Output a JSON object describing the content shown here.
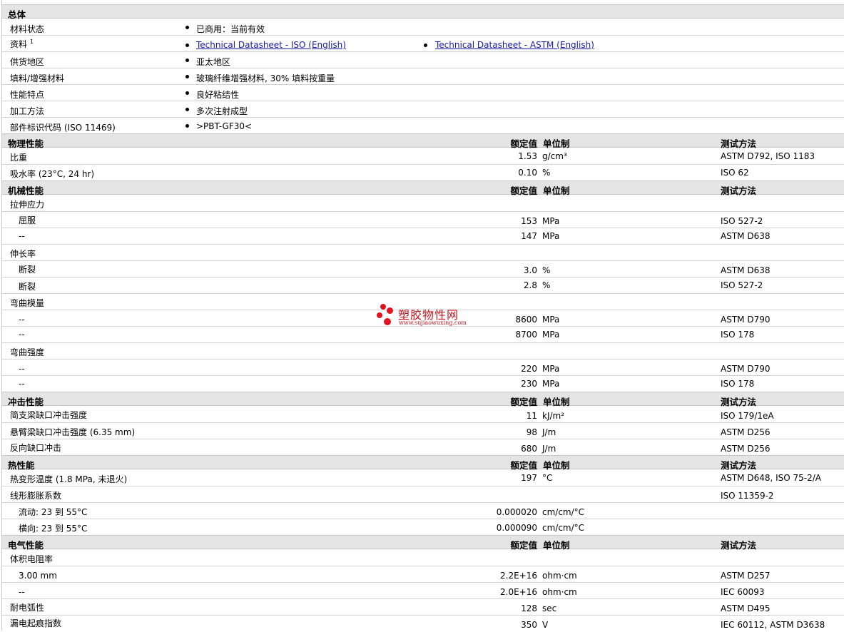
{
  "general": {
    "title": "总体",
    "material_status": {
      "label": "材料状态",
      "value": "已商用：当前有效"
    },
    "resources": {
      "label": "资料",
      "sup": "1",
      "links": [
        "Technical Datasheet - ISO (English)",
        "Technical Datasheet - ASTM (English)"
      ]
    },
    "supply_region": {
      "label": "供货地区",
      "value": "亚太地区"
    },
    "filler": {
      "label": "填料/增强材料",
      "value": "玻璃纤维增强材料, 30% 填料按重量"
    },
    "features": {
      "label": "性能特点",
      "value": "良好粘结性"
    },
    "processing": {
      "label": "加工方法",
      "value": "多次注射成型"
    },
    "part_marking": {
      "label": "部件标识代码",
      "label_note": "(ISO 11469)",
      "value": ">PBT-GF30<"
    }
  },
  "columns": {
    "nominal": "额定值",
    "unit": "单位制",
    "test": "测试方法"
  },
  "sections": {
    "physical": {
      "title": "物理性能",
      "rows": [
        {
          "label": "比重",
          "value": "1.53",
          "unit": "g/cm³",
          "test": "ASTM D792, ISO 1183"
        },
        {
          "label": "吸水率",
          "note": "(23°C, 24 hr)",
          "value": "0.10",
          "unit": "%",
          "test": "ISO 62"
        }
      ]
    },
    "mechanical": {
      "title": "机械性能",
      "tensile": {
        "label": "拉伸应力",
        "rows": [
          {
            "label": "屈服",
            "value": "153",
            "unit": "MPa",
            "test": "ISO 527-2"
          },
          {
            "label": "--",
            "value": "147",
            "unit": "MPa",
            "test": "ASTM D638"
          }
        ]
      },
      "elongation": {
        "label": "伸长率",
        "rows": [
          {
            "label": "断裂",
            "value": "3.0",
            "unit": "%",
            "test": "ASTM D638"
          },
          {
            "label": "断裂",
            "value": "2.8",
            "unit": "%",
            "test": "ISO 527-2"
          }
        ]
      },
      "flex_modulus": {
        "label": "弯曲模量",
        "rows": [
          {
            "label": "--",
            "value": "8600",
            "unit": "MPa",
            "test": "ASTM D790"
          },
          {
            "label": "--",
            "value": "8700",
            "unit": "MPa",
            "test": "ISO 178"
          }
        ]
      },
      "flex_strength": {
        "label": "弯曲强度",
        "rows": [
          {
            "label": "--",
            "value": "220",
            "unit": "MPa",
            "test": "ASTM D790"
          },
          {
            "label": "--",
            "value": "230",
            "unit": "MPa",
            "test": "ISO 178"
          }
        ]
      }
    },
    "impact": {
      "title": "冲击性能",
      "rows": [
        {
          "label": "简支梁缺口冲击强度",
          "value": "11",
          "unit": "kJ/m²",
          "test": "ISO 179/1eA"
        },
        {
          "label": "悬臂梁缺口冲击强度",
          "note": "(6.35 mm)",
          "value": "98",
          "unit": "J/m",
          "test": "ASTM D256"
        },
        {
          "label": "反向缺口冲击",
          "value": "680",
          "unit": "J/m",
          "test": "ASTM D256"
        }
      ]
    },
    "thermal": {
      "title": "热性能",
      "hdt": {
        "label": "热变形温度",
        "note": "(1.8 MPa, 未退火)",
        "value": "197",
        "unit": "°C",
        "test": "ASTM D648, ISO 75-2/A"
      },
      "clte": {
        "label": "线形膨胀系数",
        "test": "ISO 11359-2",
        "rows": [
          {
            "label": "流动: 23 到  55°C",
            "value": "0.000020",
            "unit": "cm/cm/°C"
          },
          {
            "label": "横向: 23 到  55°C",
            "value": "0.000090",
            "unit": "cm/cm/°C"
          }
        ]
      }
    },
    "electrical": {
      "title": "电气性能",
      "volume_resistivity": {
        "label": "体积电阻率",
        "rows": [
          {
            "label": "3.00 mm",
            "value": "2.2E+16",
            "unit": "ohm·cm",
            "test": "ASTM D257"
          },
          {
            "label": "--",
            "value": "2.0E+16",
            "unit": "ohm·cm",
            "test": "IEC 60093"
          }
        ]
      },
      "arc_resistance": {
        "label": "耐电弧性",
        "value": "128",
        "unit": "sec",
        "test": "ASTM D495"
      },
      "cti": {
        "label": "漏电起痕指数",
        "value": "350",
        "unit": "V",
        "test": "IEC 60112, ASTM D3638"
      }
    }
  },
  "watermark": {
    "title": "塑胶物性网",
    "url": "www.sujiaowuxing.com"
  },
  "colors": {
    "header_bg": "#e4e4e4",
    "link": "#1a1aa6",
    "watermark": "#e0141e"
  }
}
